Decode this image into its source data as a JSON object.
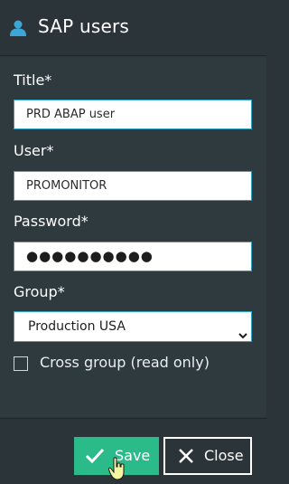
{
  "dialog": {
    "title": "SAP users",
    "title_icon": "user-icon"
  },
  "form": {
    "title_label": "Title*",
    "title_value": "PRD ABAP user",
    "user_label": "User*",
    "user_value": "PROMONITOR",
    "password_label": "Password*",
    "password_value": "●●●●●●●●●●",
    "group_label": "Group*",
    "group_value": "Production USA",
    "cross_group_label": "Cross group (read only)",
    "cross_group_checked": false
  },
  "footer": {
    "save_label": "Save",
    "close_label": "Close"
  },
  "colors": {
    "background": "#2f3a3e",
    "accent_blue": "#2fa3c7",
    "save_green": "#2bbb8a"
  }
}
